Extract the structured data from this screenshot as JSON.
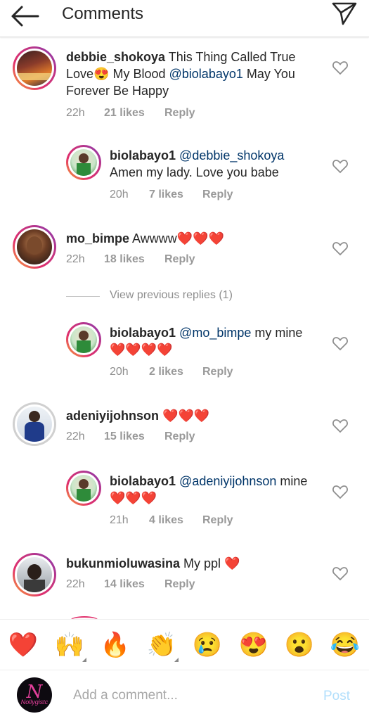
{
  "header": {
    "title": "Comments"
  },
  "comments": [
    {
      "user": "debbie_shokoya",
      "text_before": " This Thing Called True Love",
      "emoji": "😍",
      "text_mid": " My Blood ",
      "mention": "@biolabayo1",
      "text_after": " May You Forever Be Happy",
      "time": "22h",
      "likes": "21 likes",
      "reply": "Reply"
    },
    {
      "user": "biolabayo1",
      "mention": "@debbie_shokoya",
      "text": "Amen my lady. Love you babe",
      "time": "20h",
      "likes": "7 likes",
      "reply": "Reply"
    },
    {
      "user": "mo_bimpe",
      "text": " Awwww",
      "hearts": "❤️❤️❤️",
      "time": "22h",
      "likes": "18 likes",
      "reply": "Reply"
    },
    {
      "user": "biolabayo1",
      "mention": "@mo_bimpe",
      "text": " my mine",
      "hearts": "❤️❤️❤️❤️",
      "time": "20h",
      "likes": "2 likes",
      "reply": "Reply"
    },
    {
      "user": "adeniyijohnson",
      "hearts": "❤️❤️❤️",
      "time": "22h",
      "likes": "15 likes",
      "reply": "Reply"
    },
    {
      "user": "biolabayo1",
      "mention": "@adeniyijohnson",
      "text": " mine",
      "hearts": "❤️❤️❤️",
      "time": "21h",
      "likes": "4 likes",
      "reply": "Reply"
    },
    {
      "user": "bukunmioluwasina",
      "text": " My ppl ",
      "hearts": "❤️",
      "time": "22h",
      "likes": "14 likes",
      "reply": "Reply"
    }
  ],
  "view_previous": "View previous replies (1)",
  "emoji_bar": [
    "❤️",
    "🙌",
    "🔥",
    "👏",
    "😢",
    "😍",
    "😮",
    "😂"
  ],
  "compose": {
    "avatar_logo": "N",
    "avatar_sub": "Nollygistc",
    "placeholder": "Add a comment...",
    "post_label": "Post"
  },
  "colors": {
    "mention": "#003569",
    "heart": "#e0202c",
    "post_disabled": "#b2dffc",
    "meta": "#8e8e8e"
  }
}
